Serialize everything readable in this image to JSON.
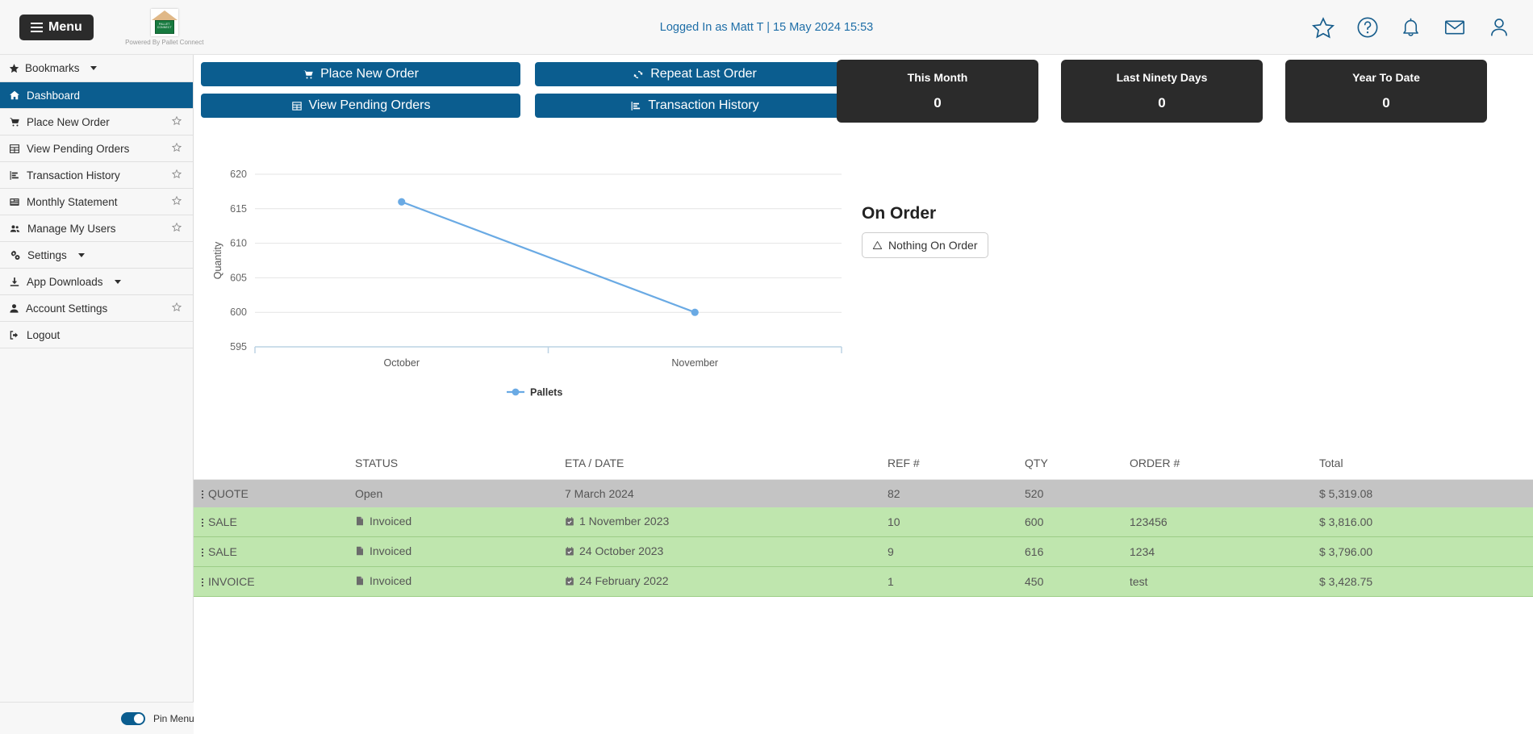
{
  "header": {
    "menu_label": "Menu",
    "brand_caption": "Powered By Pallet Connect",
    "logo_text": "PALLET CONNECT",
    "session": "Logged In as Matt T | 15 May 2024 15:53",
    "icons": [
      "star-icon",
      "help-circle-icon",
      "bell-icon",
      "envelope-icon",
      "user-icon"
    ]
  },
  "sidebar": {
    "bookmarks_label": "Bookmarks",
    "items": [
      {
        "label": "Dashboard",
        "icon": "home-icon",
        "active": true,
        "star": false,
        "caret": false
      },
      {
        "label": "Place New Order",
        "icon": "cart-icon",
        "active": false,
        "star": true,
        "caret": false
      },
      {
        "label": "View Pending Orders",
        "icon": "table-icon",
        "active": false,
        "star": true,
        "caret": false
      },
      {
        "label": "Transaction History",
        "icon": "chart-bar-icon",
        "active": false,
        "star": true,
        "caret": false
      },
      {
        "label": "Monthly Statement",
        "icon": "statement-icon",
        "active": false,
        "star": true,
        "caret": false
      },
      {
        "label": "Manage My Users",
        "icon": "users-icon",
        "active": false,
        "star": true,
        "caret": false
      },
      {
        "label": "Settings",
        "icon": "cogs-icon",
        "active": false,
        "star": false,
        "caret": true
      },
      {
        "label": "App Downloads",
        "icon": "download-icon",
        "active": false,
        "star": false,
        "caret": true
      },
      {
        "label": "Account Settings",
        "icon": "user-icon",
        "active": false,
        "star": true,
        "caret": false
      },
      {
        "label": "Logout",
        "icon": "logout-icon",
        "active": false,
        "star": false,
        "caret": false
      }
    ],
    "pin_menu_label": "Pin Menu",
    "pin_menu_on": true
  },
  "actions": [
    {
      "label": "Place New Order",
      "icon": "cart-icon"
    },
    {
      "label": "Repeat Last Order",
      "icon": "refresh-icon"
    },
    {
      "label": "View Pending Orders",
      "icon": "table-icon"
    },
    {
      "label": "Transaction History",
      "icon": "chart-bar-icon"
    }
  ],
  "stats": [
    {
      "title": "This Month",
      "value": "0"
    },
    {
      "title": "Last Ninety Days",
      "value": "0"
    },
    {
      "title": "Year To Date",
      "value": "0"
    }
  ],
  "on_order": {
    "title": "On Order",
    "empty_label": "Nothing On Order",
    "empty_icon": "warning-triangle-icon"
  },
  "chart_data": {
    "type": "line",
    "title": "",
    "categories": [
      "October",
      "November"
    ],
    "series": [
      {
        "name": "Pallets",
        "values": [
          616,
          600
        ],
        "color": "#6aaae4"
      }
    ],
    "xlabel": "",
    "ylabel": "Quantity",
    "ylim": [
      595,
      620
    ],
    "yticks": [
      595,
      600,
      605,
      610,
      615,
      620
    ],
    "grid": true,
    "legend": "bottom"
  },
  "table": {
    "columns": [
      "",
      "STATUS",
      "ETA / DATE",
      "REF #",
      "QTY",
      "ORDER #",
      "Total"
    ],
    "rows": [
      {
        "type": "QUOTE",
        "status": "Open",
        "status_icon": "",
        "eta": "7 March 2024",
        "eta_icon": "",
        "ref": "82",
        "qty": "520",
        "order": "",
        "total": "$ 5,319.08",
        "style": "quote"
      },
      {
        "type": "SALE",
        "status": "Invoiced",
        "status_icon": "pdf-icon",
        "eta": "1 November 2023",
        "eta_icon": "calendar-check-icon",
        "ref": "10",
        "qty": "600",
        "order": "123456",
        "total": "$ 3,816.00",
        "style": "green"
      },
      {
        "type": "SALE",
        "status": "Invoiced",
        "status_icon": "pdf-icon",
        "eta": "24 October 2023",
        "eta_icon": "calendar-check-icon",
        "ref": "9",
        "qty": "616",
        "order": "1234",
        "total": "$ 3,796.00",
        "style": "green"
      },
      {
        "type": "INVOICE",
        "status": "Invoiced",
        "status_icon": "pdf-icon",
        "eta": "24 February 2022",
        "eta_icon": "calendar-check-icon",
        "ref": "1",
        "qty": "450",
        "order": "test",
        "total": "$ 3,428.75",
        "style": "green"
      }
    ]
  },
  "colors": {
    "primary": "#0b5d8f",
    "dark": "#2b2b2b",
    "chart_line": "#6aaae4",
    "row_green": "#bfe6ae",
    "row_quote": "#c4c4c4"
  }
}
